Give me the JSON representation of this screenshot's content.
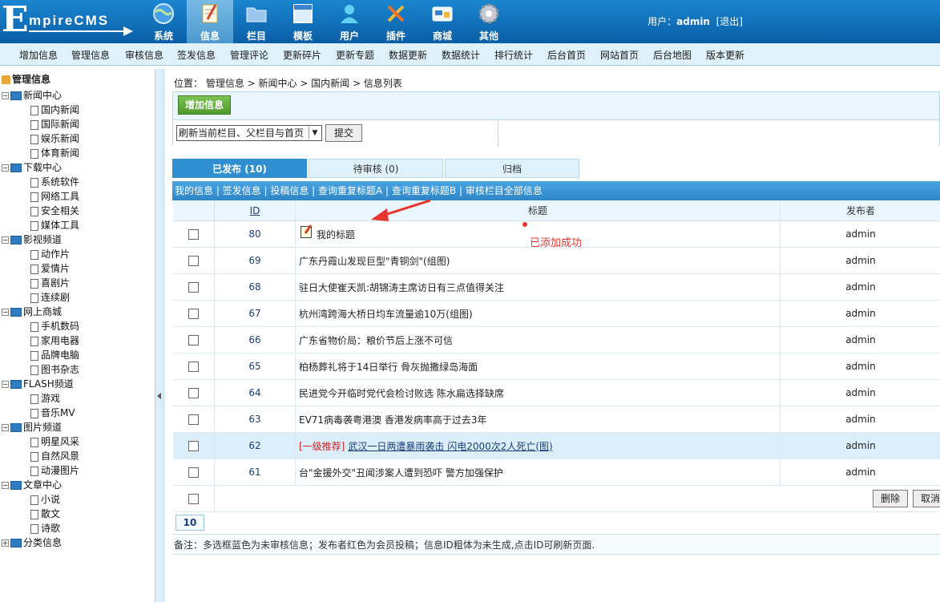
{
  "logo": {
    "first": "E",
    "rest": "mpireCMS"
  },
  "topnav": [
    {
      "label": "系统",
      "icon": "globe-icon"
    },
    {
      "label": "信息",
      "icon": "notepad-icon",
      "active": true
    },
    {
      "label": "栏目",
      "icon": "folder-icon"
    },
    {
      "label": "模板",
      "icon": "window-icon"
    },
    {
      "label": "用户",
      "icon": "user-icon"
    },
    {
      "label": "插件",
      "icon": "tools-icon"
    },
    {
      "label": "商城",
      "icon": "card-icon"
    },
    {
      "label": "其他",
      "icon": "gear-icon"
    }
  ],
  "user": {
    "prefix": "用户：",
    "name": "admin",
    "logout": "[退出]"
  },
  "submenu": [
    "增加信息",
    "管理信息",
    "审核信息",
    "签发信息",
    "管理评论",
    "更新碎片",
    "更新专题",
    "数据更新",
    "数据统计",
    "排行统计",
    "后台首页",
    "网站首页",
    "后台地图",
    "版本更新"
  ],
  "sidebar": {
    "root": "管理信息",
    "tree": [
      {
        "label": "新闻中心",
        "children": [
          "国内新闻",
          "国际新闻",
          "娱乐新闻",
          "体育新闻"
        ]
      },
      {
        "label": "下载中心",
        "children": [
          "系统软件",
          "网络工具",
          "安全相关",
          "媒体工具"
        ]
      },
      {
        "label": "影视频道",
        "children": [
          "动作片",
          "爱情片",
          "喜剧片",
          "连续剧"
        ]
      },
      {
        "label": "网上商城",
        "children": [
          "手机数码",
          "家用电器",
          "品牌电脑",
          "图书杂志"
        ]
      },
      {
        "label": "FLASH频道",
        "children": [
          "游戏",
          "音乐MV"
        ]
      },
      {
        "label": "图片频道",
        "children": [
          "明星风采",
          "自然风景",
          "动漫图片"
        ]
      },
      {
        "label": "文章中心",
        "children": [
          "小说",
          "散文",
          "诗歌"
        ]
      },
      {
        "label": "分类信息",
        "children": []
      }
    ]
  },
  "breadcrumb": "位置： 管理信息 > 新闻中心 > 国内新闻 > 信息列表",
  "add_button": "增加信息",
  "refresh_select": "刷新当前栏目、父栏目与首页",
  "submit_button": "提交",
  "tabs": [
    "已发布 (10)",
    "待审核 (0)",
    "归档"
  ],
  "linkbar": "我的信息 | 签发信息 | 投稿信息 | 查询重复标题A | 查询重复标题B | 审核栏目全部信息",
  "table": {
    "headers": {
      "id": "ID",
      "title": "标题",
      "publisher": "发布者"
    },
    "rows": [
      {
        "id": "80",
        "title": "我的标题",
        "publisher": "admin",
        "icon": true
      },
      {
        "id": "69",
        "title": "广东丹霞山发现巨型\"青铜剑\"(组图)",
        "publisher": "admin"
      },
      {
        "id": "68",
        "title": "驻日大使崔天凯:胡锦涛主席访日有三点值得关注",
        "publisher": "admin"
      },
      {
        "id": "67",
        "title": "杭州湾跨海大桥日均车流量逾10万(组图)",
        "publisher": "admin"
      },
      {
        "id": "66",
        "title": "广东省物价局：粮价节后上涨不可信",
        "publisher": "admin"
      },
      {
        "id": "65",
        "title": "柏杨葬礼将于14日举行 骨灰抛撒绿岛海面",
        "publisher": "admin"
      },
      {
        "id": "64",
        "title": "民进党今开临时党代会检讨败选 陈水扁选择缺席",
        "publisher": "admin"
      },
      {
        "id": "63",
        "title": "EV71病毒袭粤港澳 香港发病率高于过去3年",
        "publisher": "admin"
      },
      {
        "id": "62",
        "tag": "[一级推荐]",
        "title": "武汉一日两遭暴雨袭击 闪电2000次2人死亡(图)",
        "publisher": "admin",
        "hover": true
      },
      {
        "id": "61",
        "title": "台\"金援外交\"丑闻涉案人遭到恐吓 警方加强保护",
        "publisher": "admin"
      }
    ]
  },
  "annotation": "已添加成功",
  "delete_button": "删除",
  "cancel_button": "取消",
  "pager": "10",
  "note": "备注：多选框蓝色为未审核信息；发布者红色为会员投稿；信息ID粗体为未生成,点击ID可刷新页面."
}
